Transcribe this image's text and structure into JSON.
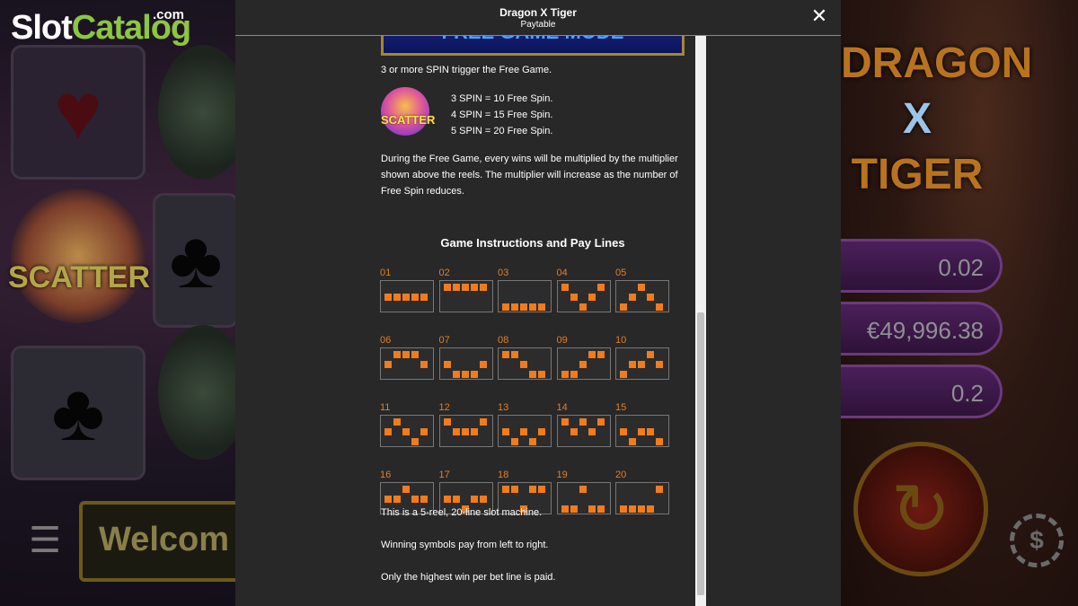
{
  "watermark": {
    "brand_part1": "Slot",
    "brand_part2": "Catalog",
    "brand_suffix": ".com"
  },
  "background_game": {
    "title_line1": "DRAGON",
    "title_line2": "X",
    "title_line3": "TIGER",
    "bet_value": "0.02",
    "balance_value": "€49,996.38",
    "total_bet_value": "0.2",
    "welcome_text": "Welcom",
    "scatter_label": "SCATTER"
  },
  "modal": {
    "title": "Dragon X Tiger",
    "subtitle": "Paytable",
    "close_icon": "close-icon",
    "banner_text": "FREE GAME MODE",
    "free_game_trigger": "3 or more SPIN trigger the Free Game.",
    "scatter_icon_label": "SCATTER",
    "spin_rules": [
      "3 SPIN = 10 Free Spin.",
      "4 SPIN = 15 Free Spin.",
      "5 SPIN = 20 Free Spin."
    ],
    "multiplier_text": "During the Free Game, every wins will be multiplied by the multiplier shown above the reels. The multiplier will increase as the number of Free Spin reduces.",
    "section_title": "Game Instructions and Pay Lines",
    "paylines": [
      {
        "number": "01",
        "rows": [
          1,
          1,
          1,
          1,
          1
        ]
      },
      {
        "number": "02",
        "rows": [
          0,
          0,
          0,
          0,
          0
        ]
      },
      {
        "number": "03",
        "rows": [
          2,
          2,
          2,
          2,
          2
        ]
      },
      {
        "number": "04",
        "rows": [
          0,
          1,
          2,
          1,
          0
        ]
      },
      {
        "number": "05",
        "rows": [
          2,
          1,
          0,
          1,
          2
        ]
      },
      {
        "number": "06",
        "rows": [
          1,
          0,
          0,
          0,
          1
        ]
      },
      {
        "number": "07",
        "rows": [
          1,
          2,
          2,
          2,
          1
        ]
      },
      {
        "number": "08",
        "rows": [
          0,
          0,
          1,
          2,
          2
        ]
      },
      {
        "number": "09",
        "rows": [
          2,
          2,
          1,
          0,
          0
        ]
      },
      {
        "number": "10",
        "rows": [
          2,
          1,
          1,
          0,
          1
        ]
      },
      {
        "number": "11",
        "rows": [
          1,
          0,
          1,
          2,
          1
        ]
      },
      {
        "number": "12",
        "rows": [
          0,
          1,
          1,
          1,
          0
        ]
      },
      {
        "number": "13",
        "rows": [
          1,
          2,
          1,
          2,
          1
        ]
      },
      {
        "number": "14",
        "rows": [
          0,
          1,
          0,
          1,
          0
        ]
      },
      {
        "number": "15",
        "rows": [
          1,
          2,
          1,
          1,
          2
        ]
      },
      {
        "number": "16",
        "rows": [
          1,
          1,
          0,
          1,
          1
        ]
      },
      {
        "number": "17",
        "rows": [
          1,
          1,
          2,
          1,
          1
        ]
      },
      {
        "number": "18",
        "rows": [
          0,
          0,
          2,
          0,
          0
        ]
      },
      {
        "number": "19",
        "rows": [
          2,
          2,
          0,
          2,
          2
        ]
      },
      {
        "number": "20",
        "rows": [
          2,
          2,
          2,
          2,
          0
        ]
      }
    ],
    "info_lines": [
      "This is a 5-reel, 20-line slot machine.",
      "Winning symbols pay from left to right.",
      "Only the highest win per bet line is paid."
    ],
    "accent_color": "#f07c1c"
  }
}
